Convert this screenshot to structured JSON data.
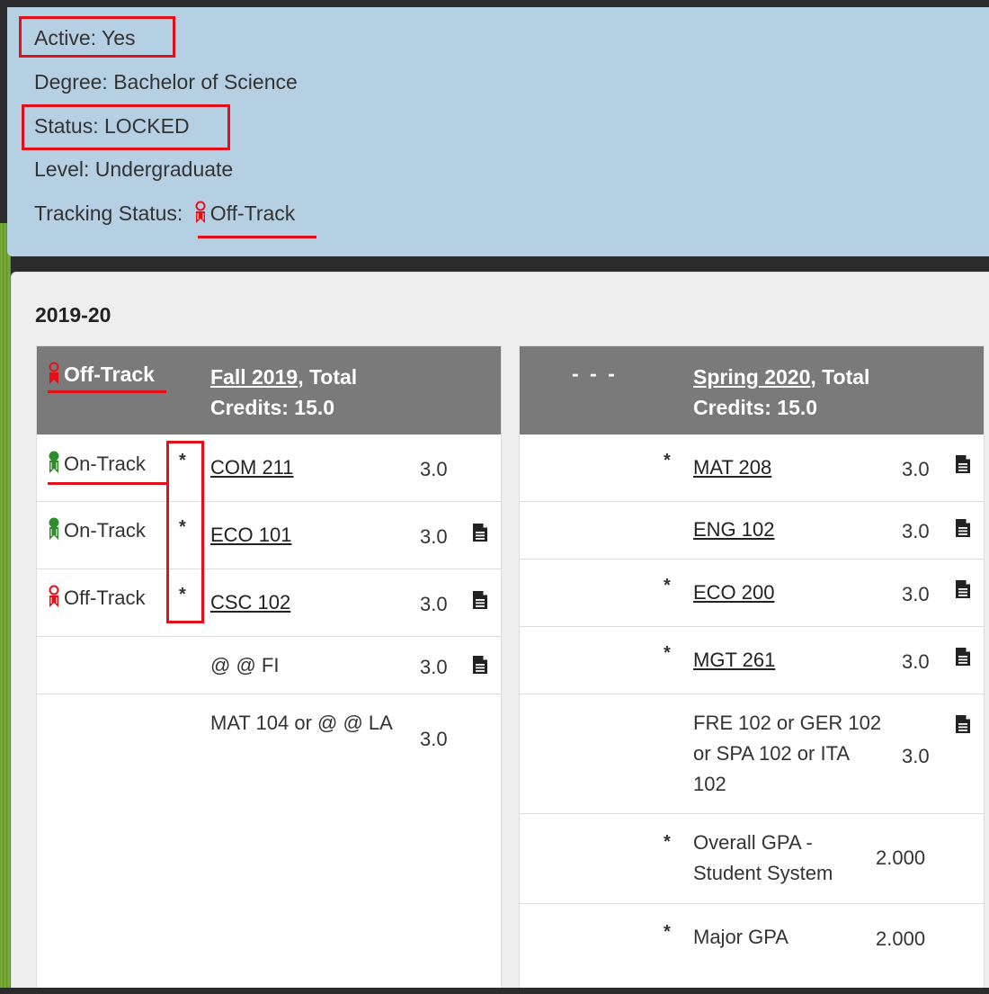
{
  "info": {
    "active": "Active: Yes",
    "degree": "Degree: Bachelor of Science",
    "status": "Status: LOCKED",
    "level": "Level: Undergraduate",
    "tracking_label": "Tracking Status:",
    "tracking_value": "Off-Track"
  },
  "year": {
    "title": "2019-20"
  },
  "fall": {
    "track": "Off-Track",
    "term_link": "Fall 2019",
    "term_suffix": ", Total",
    "credits": "Credits: 15.0",
    "rows": [
      {
        "track": "On-Track",
        "star": "*",
        "course": "COM 211",
        "credits": "3.0"
      },
      {
        "track": "On-Track",
        "star": "*",
        "course": "ECO 101",
        "credits": "3.0"
      },
      {
        "track": "Off-Track",
        "star": "*",
        "course": "CSC 102",
        "credits": "3.0"
      },
      {
        "course": "@ @ FI",
        "credits": "3.0"
      },
      {
        "course": "MAT 104 or @ @ LA",
        "credits": "3.0"
      }
    ]
  },
  "spring": {
    "dashes": "- - -",
    "term_link": "Spring 2020",
    "term_suffix": ", Total",
    "credits": "Credits: 15.0",
    "rows": [
      {
        "star": "*",
        "course": "MAT 208",
        "credits": "3.0"
      },
      {
        "course": "ENG 102",
        "credits": "3.0"
      },
      {
        "star": "*",
        "course": "ECO 200",
        "credits": "3.0"
      },
      {
        "star": "*",
        "course": "MGT 261",
        "credits": "3.0"
      },
      {
        "course": "FRE 102 or GER 102 or SPA 102 or ITA 102",
        "credits": "3.0"
      },
      {
        "star": "*",
        "course": "Overall GPA - Student System",
        "credits": "2.000"
      },
      {
        "star": "*",
        "course": "Major GPA",
        "credits": "2.000"
      }
    ]
  },
  "icons": {
    "on_track": "green-ribbon-icon",
    "off_track": "red-ribbon-icon",
    "document": "document-icon"
  },
  "colors": {
    "info_bg": "#b5cfe3",
    "header_bg": "#7a7a7a",
    "highlight_red": "#e3101a",
    "on_track_green": "#2e8b2e",
    "off_track_red": "#e3101a"
  }
}
